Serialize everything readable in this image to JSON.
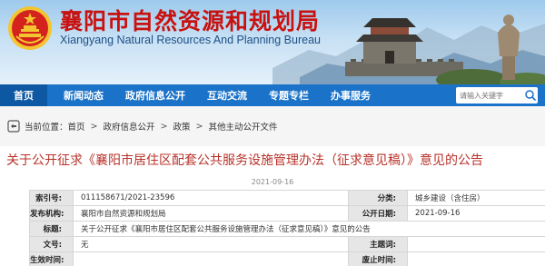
{
  "site": {
    "title": "襄阳市自然资源和规划局",
    "title_en": "Xiangyang Natural Resources And Planning Bureau",
    "theme_color": "#1a73c9",
    "title_color": "#c81210"
  },
  "nav": {
    "items": [
      {
        "label": "首页",
        "active": true
      },
      {
        "label": "新闻动态"
      },
      {
        "label": "政府信息公开"
      },
      {
        "label": "互动交流"
      },
      {
        "label": "专题专栏"
      },
      {
        "label": "办事服务"
      }
    ],
    "search_placeholder": "请输入关键字"
  },
  "breadcrumb": {
    "prefix": "当前位置：",
    "items": [
      "首页",
      "政府信息公开",
      "政策",
      "其他主动公开文件"
    ],
    "separator": ">"
  },
  "article": {
    "title": "关于公开征求《襄阳市居住区配套公共服务设施管理办法（征求意见稿）》意见的公告",
    "date": "2021-09-16"
  },
  "info": {
    "index_label": "索引号:",
    "index_value": "011158671/2021-23596",
    "category_label": "分类:",
    "category_value": "城乡建设（含住房）",
    "issuer_label": "发布机构:",
    "issuer_value": "襄阳市自然资源和规划局",
    "pubdate_label": "公开日期:",
    "pubdate_value": "2021-09-16",
    "title_label": "标题:",
    "title_value": "关于公开征求《襄阳市居住区配套公共服务设施管理办法（征求意见稿）》意见的公告",
    "docno_label": "文号:",
    "docno_value": "无",
    "theme_label": "主题词:",
    "theme_value": "",
    "effective_label": "生效时间:",
    "effective_value": "",
    "expire_label": "废止时间:",
    "expire_value": ""
  }
}
